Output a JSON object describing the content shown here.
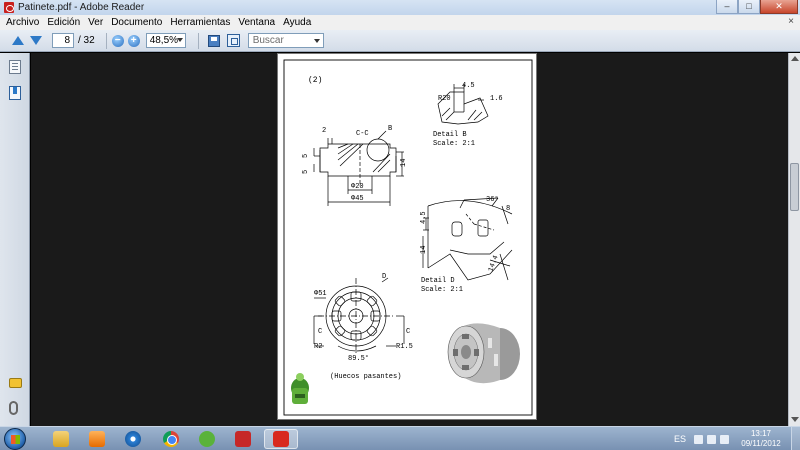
{
  "window": {
    "title": "Patinete.pdf - Adobe Reader",
    "controls": {
      "minimize": "‒",
      "maximize": "□",
      "close": "✕"
    }
  },
  "menu": {
    "items": [
      "Archivo",
      "Edición",
      "Ver",
      "Documento",
      "Herramientas",
      "Ventana",
      "Ayuda"
    ],
    "close_doc": "×"
  },
  "toolbar": {
    "page_current": "8",
    "page_total": "/ 32",
    "zoom_out": "−",
    "zoom_in": "+",
    "zoom_value": "48,5%",
    "search_placeholder": "Buscar"
  },
  "drawing": {
    "sheet_label": "(2)",
    "section_label": "C-C",
    "dim_2": "2",
    "callout_b": "B",
    "dim_5a": "5",
    "dim_5b": "5",
    "dim_14": "14",
    "dim_phi20": "Φ20",
    "dim_phi45": "Φ45",
    "detail_b_title": "Detail B",
    "detail_b_scale": "Scale:  2:1",
    "dim_4_5": "4.5",
    "dim_r20": "R20",
    "dim_1_6": "1.6",
    "dim_36": "36°",
    "dim_8": "8",
    "dim_4_5v": "4.5",
    "dim_14v": "14",
    "dim_14_4": "14.4",
    "detail_d_title": "Detail D",
    "detail_d_scale": "Scale:  2:1",
    "callout_d": "D",
    "dim_phi51": "Φ51",
    "cut_c_left": "C",
    "cut_c_right": "C",
    "dim_r2": "R2",
    "dim_r1_5": "R1.5",
    "dim_89_5": "89.5°",
    "note": "(Huecos pasantes)"
  },
  "taskbar": {
    "language": "ES",
    "time": "13:17",
    "date": "09/11/2012"
  },
  "icons": [
    "pdf-app-icon",
    "arrow-up-icon",
    "arrow-down-icon",
    "zoom-out-icon",
    "zoom-in-icon",
    "save-icon",
    "fit-page-icon",
    "pages-icon",
    "bookmarks-icon",
    "comments-icon",
    "attachments-icon",
    "windows-start-icon",
    "explorer-icon",
    "media-player-icon",
    "internet-explorer-icon",
    "chrome-icon",
    "utorrent-icon",
    "solidworks-icon",
    "adobe-reader-icon"
  ]
}
